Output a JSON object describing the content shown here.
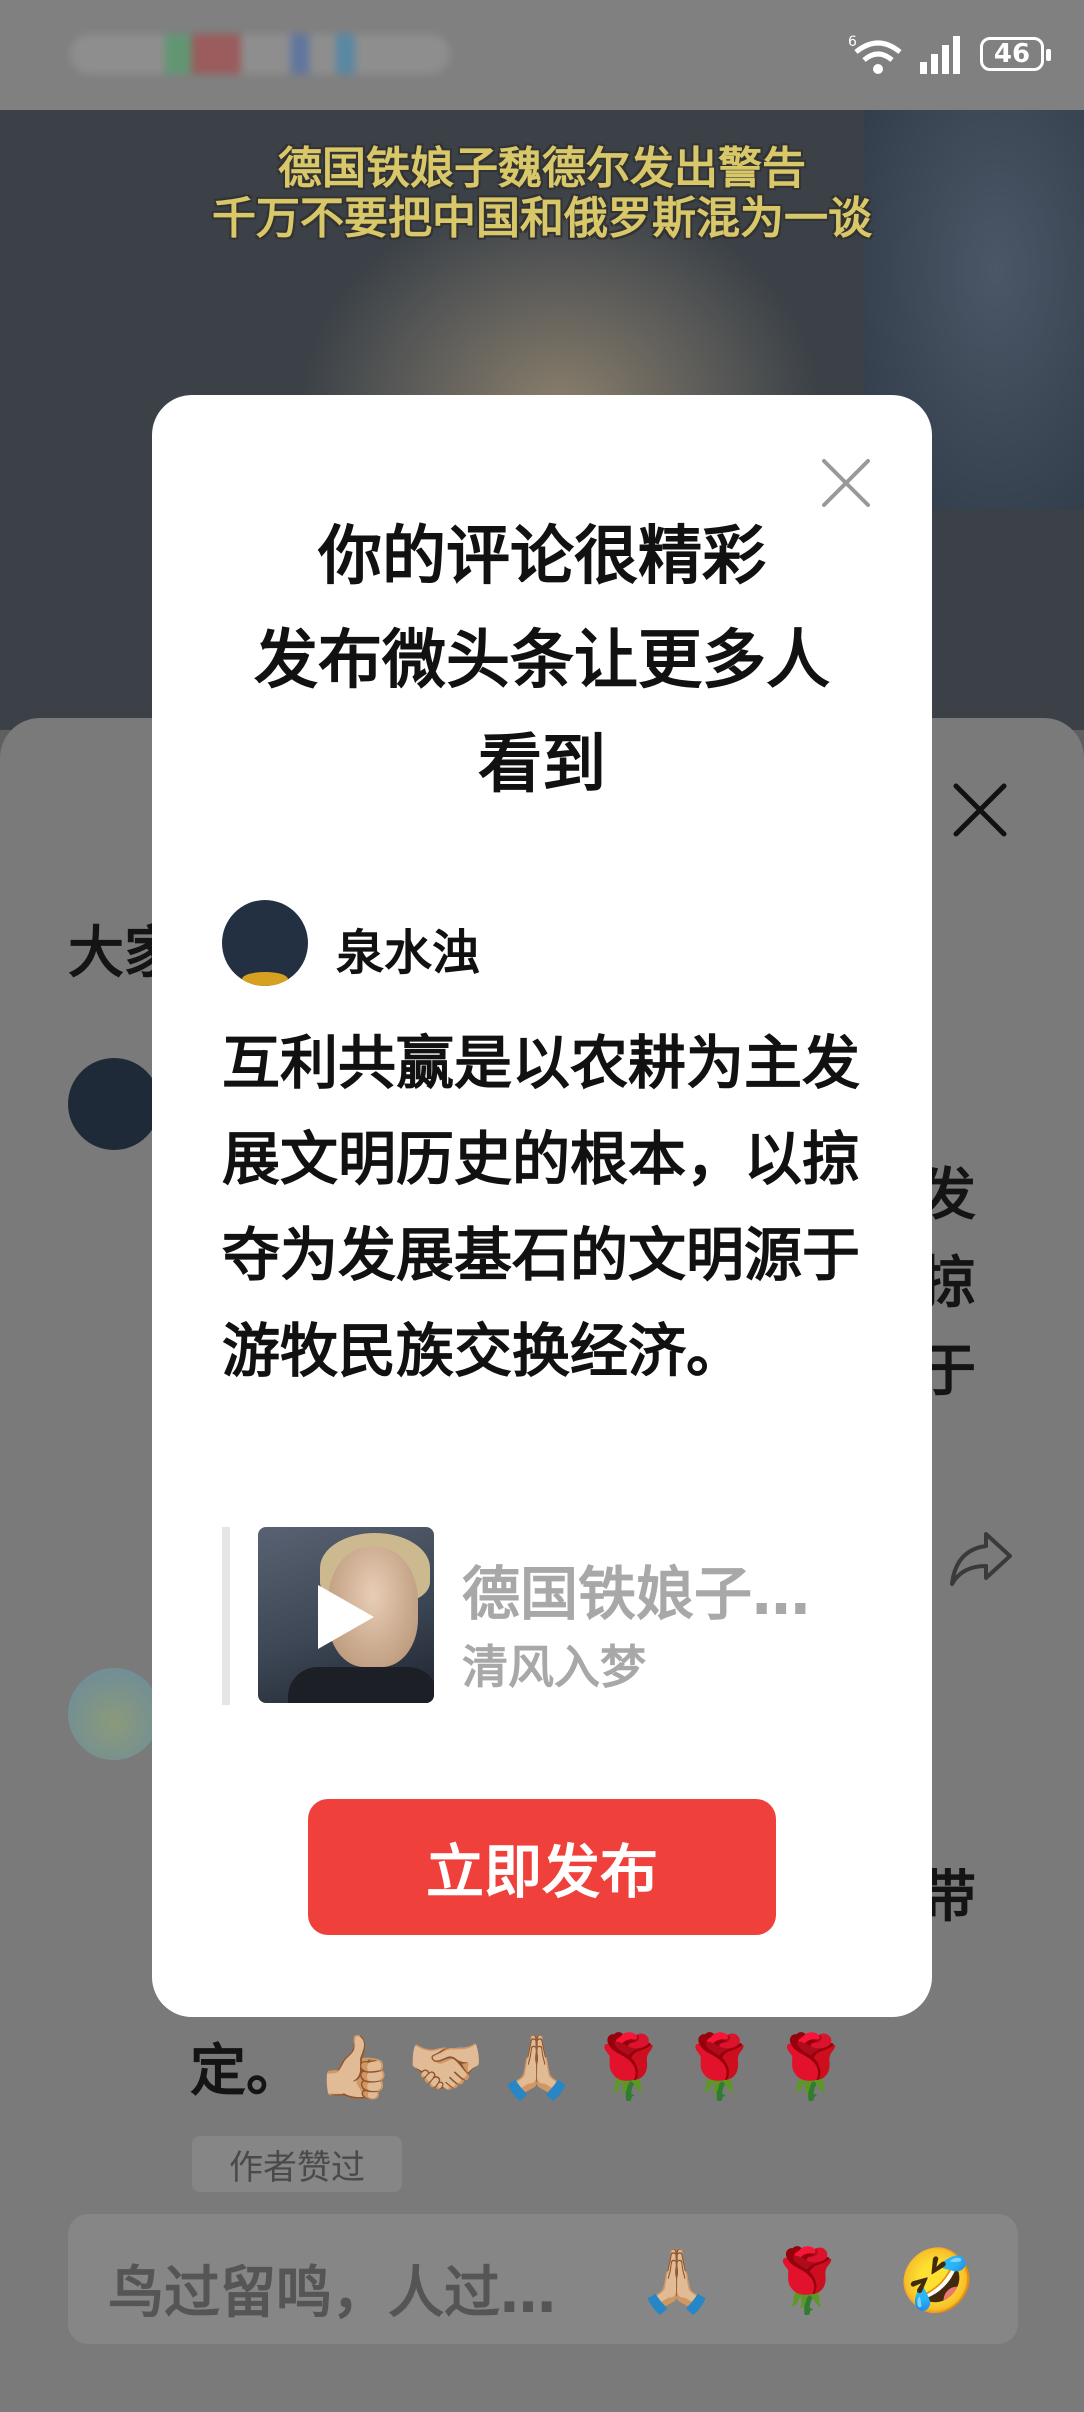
{
  "status_bar": {
    "network_badge": "6",
    "battery": "46"
  },
  "video": {
    "subtitle_line1": "德国铁娘子魏德尔发出警告",
    "subtitle_line2": "千万不要把中国和俄罗斯混为一谈"
  },
  "background": {
    "section_title_partial": "大家",
    "row1_fragments": [
      "发",
      "掠",
      "于"
    ],
    "row2_fragment": "带",
    "comment_end_text": "定。",
    "comment_emojis": [
      "👍🏼",
      "🤝🏼",
      "🙏🏼",
      "🌹",
      "🌹",
      "🌹"
    ],
    "author_like_chip": "作者赞过",
    "input_placeholder": "鸟过留鸣，人过…",
    "input_emojis": [
      "🙏🏼",
      "🌹",
      "🤣"
    ]
  },
  "modal": {
    "title_line1": "你的评论很精彩",
    "title_line2": "发布微头条让更多人",
    "title_line3": "看到",
    "author_name": "泉水浊",
    "comment_text": "互利共赢是以农耕为主发展文明历史的根本，以掠夺为发展基石的文明源于游牧民族交换经济。",
    "quote_title": "德国铁娘子…",
    "quote_source": "清风入梦",
    "publish_button": "立即发布"
  }
}
